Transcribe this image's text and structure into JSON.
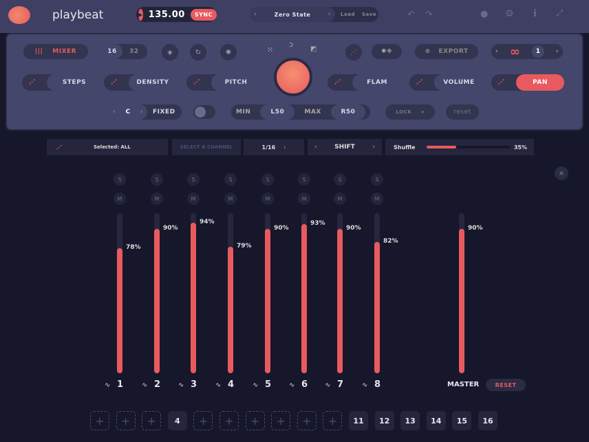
{
  "header": {
    "app_name": "playbeat",
    "bpm": "135.00",
    "sync_label": "SYNC",
    "preset_name": "Zero State",
    "load_label": "Load",
    "save_label": "Save"
  },
  "toolbar": {
    "mixer_label": "MIXER",
    "steps_16": "16",
    "steps_32": "32",
    "export_label": "EXPORT",
    "loop_count": "1"
  },
  "params": {
    "steps": "STEPS",
    "density": "DENSITY",
    "pitch": "PITCH",
    "flam": "FLAM",
    "volume": "VOLUME",
    "pan": "PAN"
  },
  "pan_row": {
    "key": "C",
    "fixed": "FIXED",
    "min_label": "MIN",
    "min_value": "L50",
    "max_label": "MAX",
    "max_value": "R50",
    "lock_label": "LOCK",
    "reset_label": "reset"
  },
  "channel_bar": {
    "selected": "Selected: ALL",
    "select_channel": "SELECT A CHANNEL",
    "division": "1/16",
    "shift": "SHIFT",
    "shuffle_label": "Shuffle",
    "shuffle_value": "35%",
    "shuffle_fraction": 0.35
  },
  "accent_color": "#e85a5f",
  "mixer": {
    "solo": "S",
    "mute": "M",
    "channels": [
      {
        "label": "1",
        "volume": 78
      },
      {
        "label": "2",
        "volume": 90
      },
      {
        "label": "3",
        "volume": 94
      },
      {
        "label": "4",
        "volume": 79
      },
      {
        "label": "5",
        "volume": 90
      },
      {
        "label": "6",
        "volume": 93
      },
      {
        "label": "7",
        "volume": 90
      },
      {
        "label": "8",
        "volume": 82
      }
    ],
    "master_label": "MASTER",
    "master_volume": 90,
    "reset_label": "RESET"
  },
  "slots": [
    "+",
    "+",
    "+",
    "4",
    "+",
    "+",
    "+",
    "+",
    "+",
    "+",
    "11",
    "12",
    "13",
    "14",
    "15",
    "16"
  ]
}
